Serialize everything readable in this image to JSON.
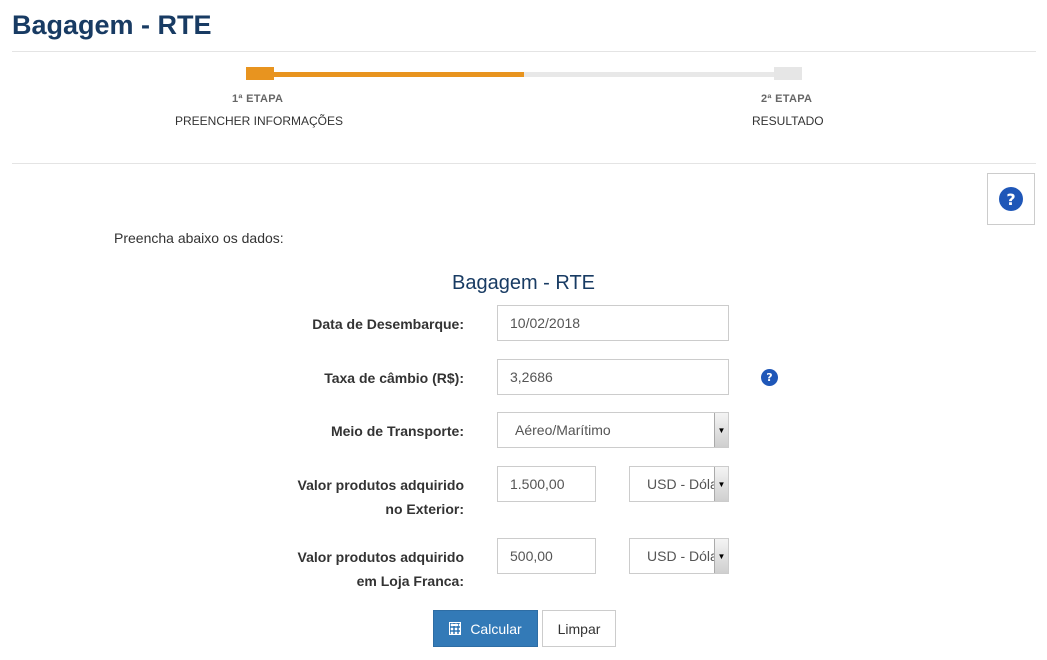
{
  "header": {
    "title": "Bagagem - RTE"
  },
  "steps": {
    "progress_percent": 50,
    "items": [
      {
        "number": "1ª ETAPA",
        "name": "PREENCHER INFORMAÇÕES"
      },
      {
        "number": "2ª ETAPA",
        "name": "RESULTADO"
      }
    ]
  },
  "help": {
    "icon": "question-circle-icon",
    "glyph": "?"
  },
  "intro": "Preencha abaixo os dados:",
  "form": {
    "title": "Bagagem - RTE",
    "date_label": "Data de Desembarque:",
    "date_value": "10/02/2018",
    "rate_label": "Taxa de câmbio (R$):",
    "rate_value": "3,2686",
    "transport_label": "Meio de Transporte:",
    "transport_value": "Aéreo/Marítimo",
    "exterior_label_1": "Valor produtos adquirido",
    "exterior_label_2": "no Exterior:",
    "exterior_value": "1.500,00",
    "exterior_currency": "USD - Dólar",
    "franca_label_1": "Valor produtos adquirido",
    "franca_label_2": "em Loja Franca:",
    "franca_value": "500,00",
    "franca_currency": "USD - Dólar"
  },
  "buttons": {
    "calcular": "Calcular",
    "limpar": "Limpar"
  },
  "colors": {
    "title": "#183b63",
    "accent": "#e8941f",
    "primary": "#337ab7",
    "help": "#1f57b8"
  }
}
